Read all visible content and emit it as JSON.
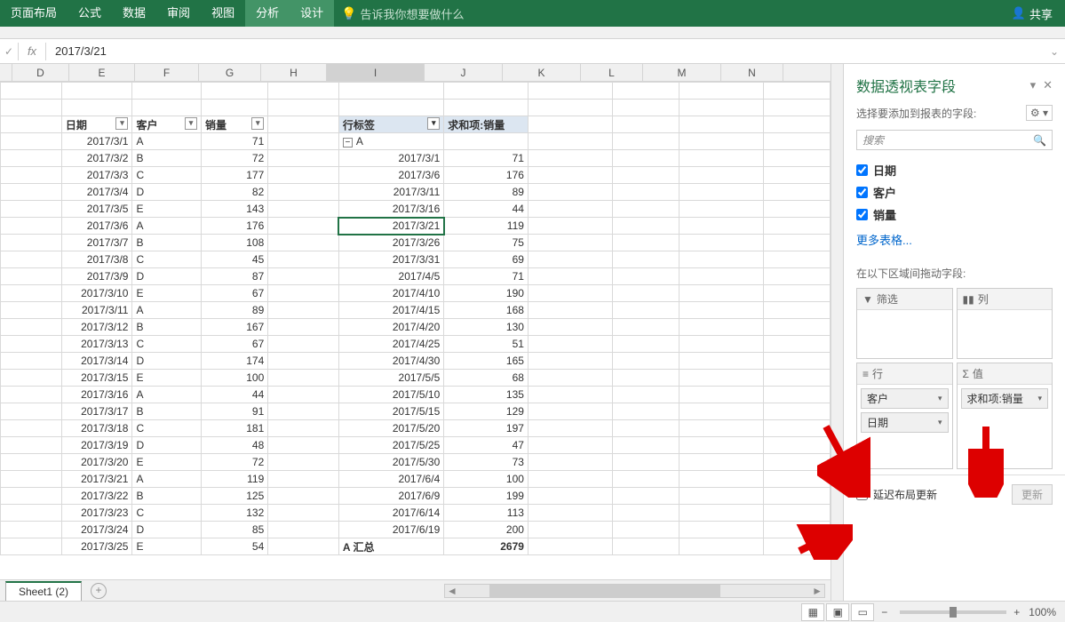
{
  "ribbon": {
    "tabs": [
      "页面布局",
      "公式",
      "数据",
      "审阅",
      "视图",
      "分析",
      "设计"
    ],
    "active": [
      5,
      6
    ],
    "tellme": "告诉我你想要做什么",
    "share": "共享"
  },
  "formula": {
    "value": "2017/3/21"
  },
  "columns": [
    "D",
    "E",
    "F",
    "G",
    "H",
    "I",
    "J",
    "K",
    "L",
    "M",
    "N"
  ],
  "active_col": "I",
  "table": {
    "headers": [
      "日期",
      "客户",
      "销量"
    ],
    "rows": [
      [
        "2017/3/1",
        "A",
        "71"
      ],
      [
        "2017/3/2",
        "B",
        "72"
      ],
      [
        "2017/3/3",
        "C",
        "177"
      ],
      [
        "2017/3/4",
        "D",
        "82"
      ],
      [
        "2017/3/5",
        "E",
        "143"
      ],
      [
        "2017/3/6",
        "A",
        "176"
      ],
      [
        "2017/3/7",
        "B",
        "108"
      ],
      [
        "2017/3/8",
        "C",
        "45"
      ],
      [
        "2017/3/9",
        "D",
        "87"
      ],
      [
        "2017/3/10",
        "E",
        "67"
      ],
      [
        "2017/3/11",
        "A",
        "89"
      ],
      [
        "2017/3/12",
        "B",
        "167"
      ],
      [
        "2017/3/13",
        "C",
        "67"
      ],
      [
        "2017/3/14",
        "D",
        "174"
      ],
      [
        "2017/3/15",
        "E",
        "100"
      ],
      [
        "2017/3/16",
        "A",
        "44"
      ],
      [
        "2017/3/17",
        "B",
        "91"
      ],
      [
        "2017/3/18",
        "C",
        "181"
      ],
      [
        "2017/3/19",
        "D",
        "48"
      ],
      [
        "2017/3/20",
        "E",
        "72"
      ],
      [
        "2017/3/21",
        "A",
        "119"
      ],
      [
        "2017/3/22",
        "B",
        "125"
      ],
      [
        "2017/3/23",
        "C",
        "132"
      ],
      [
        "2017/3/24",
        "D",
        "85"
      ],
      [
        "2017/3/25",
        "E",
        "54"
      ]
    ]
  },
  "pivot": {
    "row_label": "行标签",
    "sum_label": "求和项:销量",
    "group": "A",
    "dates": [
      "2017/3/1",
      "2017/3/6",
      "2017/3/11",
      "2017/3/16",
      "2017/3/21",
      "2017/3/26",
      "2017/3/31",
      "2017/4/5",
      "2017/4/10",
      "2017/4/15",
      "2017/4/20",
      "2017/4/25",
      "2017/4/30",
      "2017/5/5",
      "2017/5/10",
      "2017/5/15",
      "2017/5/20",
      "2017/5/25",
      "2017/5/30",
      "2017/6/4",
      "2017/6/9",
      "2017/6/14",
      "2017/6/19"
    ],
    "values": [
      "71",
      "176",
      "89",
      "44",
      "119",
      "75",
      "69",
      "71",
      "190",
      "168",
      "130",
      "51",
      "165",
      "68",
      "135",
      "129",
      "197",
      "47",
      "73",
      "100",
      "199",
      "113",
      "200"
    ],
    "total_label": "A 汇总",
    "total_value": "2679",
    "selected_row": 4
  },
  "sheet_tab": "Sheet1 (2)",
  "panel": {
    "title": "数据透视表字段",
    "subtitle": "选择要添加到报表的字段:",
    "search": "搜索",
    "fields": [
      "日期",
      "客户",
      "销量"
    ],
    "more": "更多表格...",
    "areas_label": "在以下区域间拖动字段:",
    "areas": {
      "filter": "筛选",
      "columns": "列",
      "rows": "行",
      "values": "值"
    },
    "row_pills": [
      "客户",
      "日期"
    ],
    "value_pills": [
      "求和项:销量"
    ],
    "defer": "延迟布局更新",
    "update": "更新"
  },
  "status": {
    "zoom": "100%"
  }
}
